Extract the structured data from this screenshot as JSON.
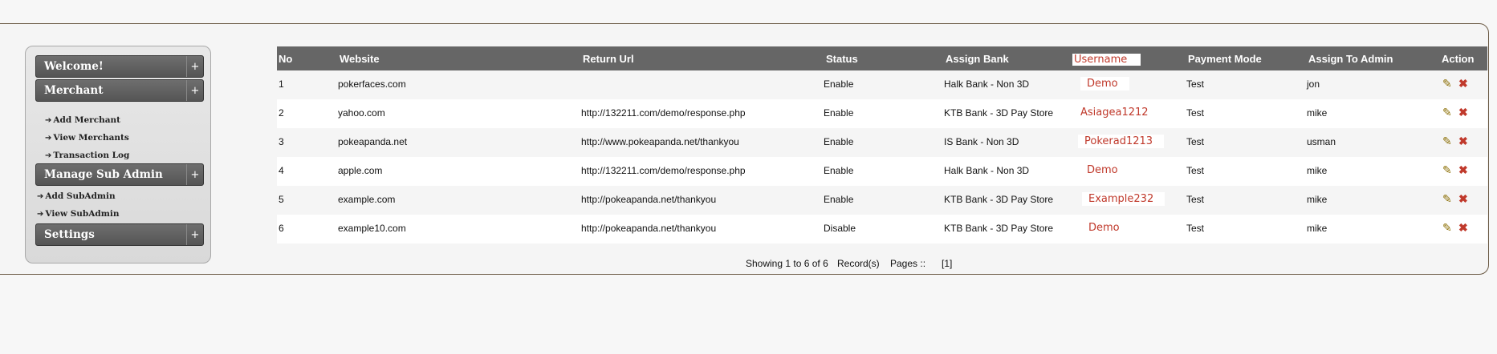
{
  "sidebar": {
    "menus": [
      {
        "label": "Welcome!",
        "toggle": "+"
      },
      {
        "label": "Merchant",
        "toggle": "+"
      },
      {
        "label": "Manage Sub Admin",
        "toggle": "+"
      },
      {
        "label": "Settings",
        "toggle": "+"
      }
    ],
    "merchant_items": [
      "Add Merchant",
      "View Merchants",
      "Transaction Log"
    ],
    "subadmin_items": [
      "Add SubAdmin",
      "View SubAdmin"
    ],
    "arrow": "➔"
  },
  "table": {
    "headers": [
      "No",
      "Website",
      "Return Url",
      "Status",
      "Assign Bank",
      "Username",
      "Payment Mode",
      "Assign To Admin",
      "Action"
    ],
    "rows": [
      {
        "no": "1",
        "website": "pokerfaces.com",
        "return_url": "",
        "status": "Enable",
        "bank": "Halk Bank - Non 3D",
        "username": "Demo",
        "mode": "Test",
        "admin": "jon"
      },
      {
        "no": "2",
        "website": "yahoo.com",
        "return_url": "http://132211.com/demo/response.php",
        "status": "Enable",
        "bank": "KTB Bank - 3D Pay Store",
        "username": "Asiagea1212",
        "mode": "Test",
        "admin": "mike"
      },
      {
        "no": "3",
        "website": "pokeapanda.net",
        "return_url": "http://www.pokeapanda.net/thankyou",
        "status": "Enable",
        "bank": "IS Bank - Non 3D",
        "username": "Pokerad1213",
        "mode": "Test",
        "admin": "usman"
      },
      {
        "no": "4",
        "website": "apple.com",
        "return_url": "http://132211.com/demo/response.php",
        "status": "Enable",
        "bank": "Halk Bank - Non 3D",
        "username": "Demo",
        "mode": "Test",
        "admin": "mike"
      },
      {
        "no": "5",
        "website": "example.com",
        "return_url": "http://pokeapanda.net/thankyou",
        "status": "Enable",
        "bank": "KTB Bank - 3D Pay Store",
        "username": "Example232",
        "mode": "Test",
        "admin": "mike"
      },
      {
        "no": "6",
        "website": "example10.com",
        "return_url": "http://pokeapanda.net/thankyou",
        "status": "Disable",
        "bank": "KTB Bank - 3D Pay Store",
        "username": "Demo",
        "mode": "Test",
        "admin": "mike"
      }
    ],
    "icons": {
      "edit": "pencil-icon",
      "delete": "x-icon"
    }
  },
  "footer": {
    "showing": "Showing 1 to 6 of 6",
    "records": "Record(s)",
    "pages_label": "Pages ::",
    "page_link": "[1]"
  }
}
